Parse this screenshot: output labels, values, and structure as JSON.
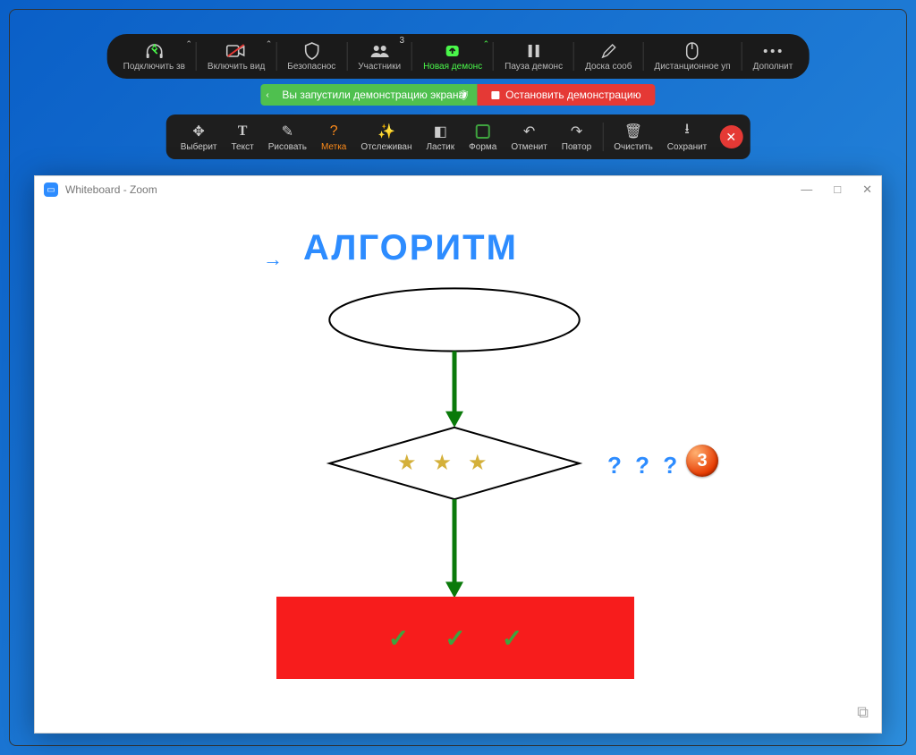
{
  "meeting_bar": {
    "audio": "Подключить зв",
    "video": "Включить вид",
    "security": "Безопаснос",
    "participants": "Участники",
    "participants_count": "3",
    "new_share": "Новая демонс",
    "pause_share": "Пауза демонс",
    "whiteboard": "Доска сооб",
    "remote": "Дистанционное уп",
    "more": "Дополнит"
  },
  "notice": {
    "sharing": "Вы запустили демонстрацию экрана",
    "stop": "Остановить демонстрацию"
  },
  "anno": {
    "select": "Выберит",
    "text": "Текст",
    "draw": "Рисовать",
    "stamp": "Метка",
    "spotlight": "Отслеживан",
    "eraser": "Ластик",
    "format": "Форма",
    "undo": "Отменит",
    "redo": "Повтор",
    "clear": "Очистить",
    "save": "Сохранит"
  },
  "window": {
    "title": "Whiteboard - Zoom"
  },
  "content": {
    "heading": "АЛГОРИТМ",
    "arrow": "→",
    "question_marks": "? ? ?",
    "circle_number": "3"
  }
}
